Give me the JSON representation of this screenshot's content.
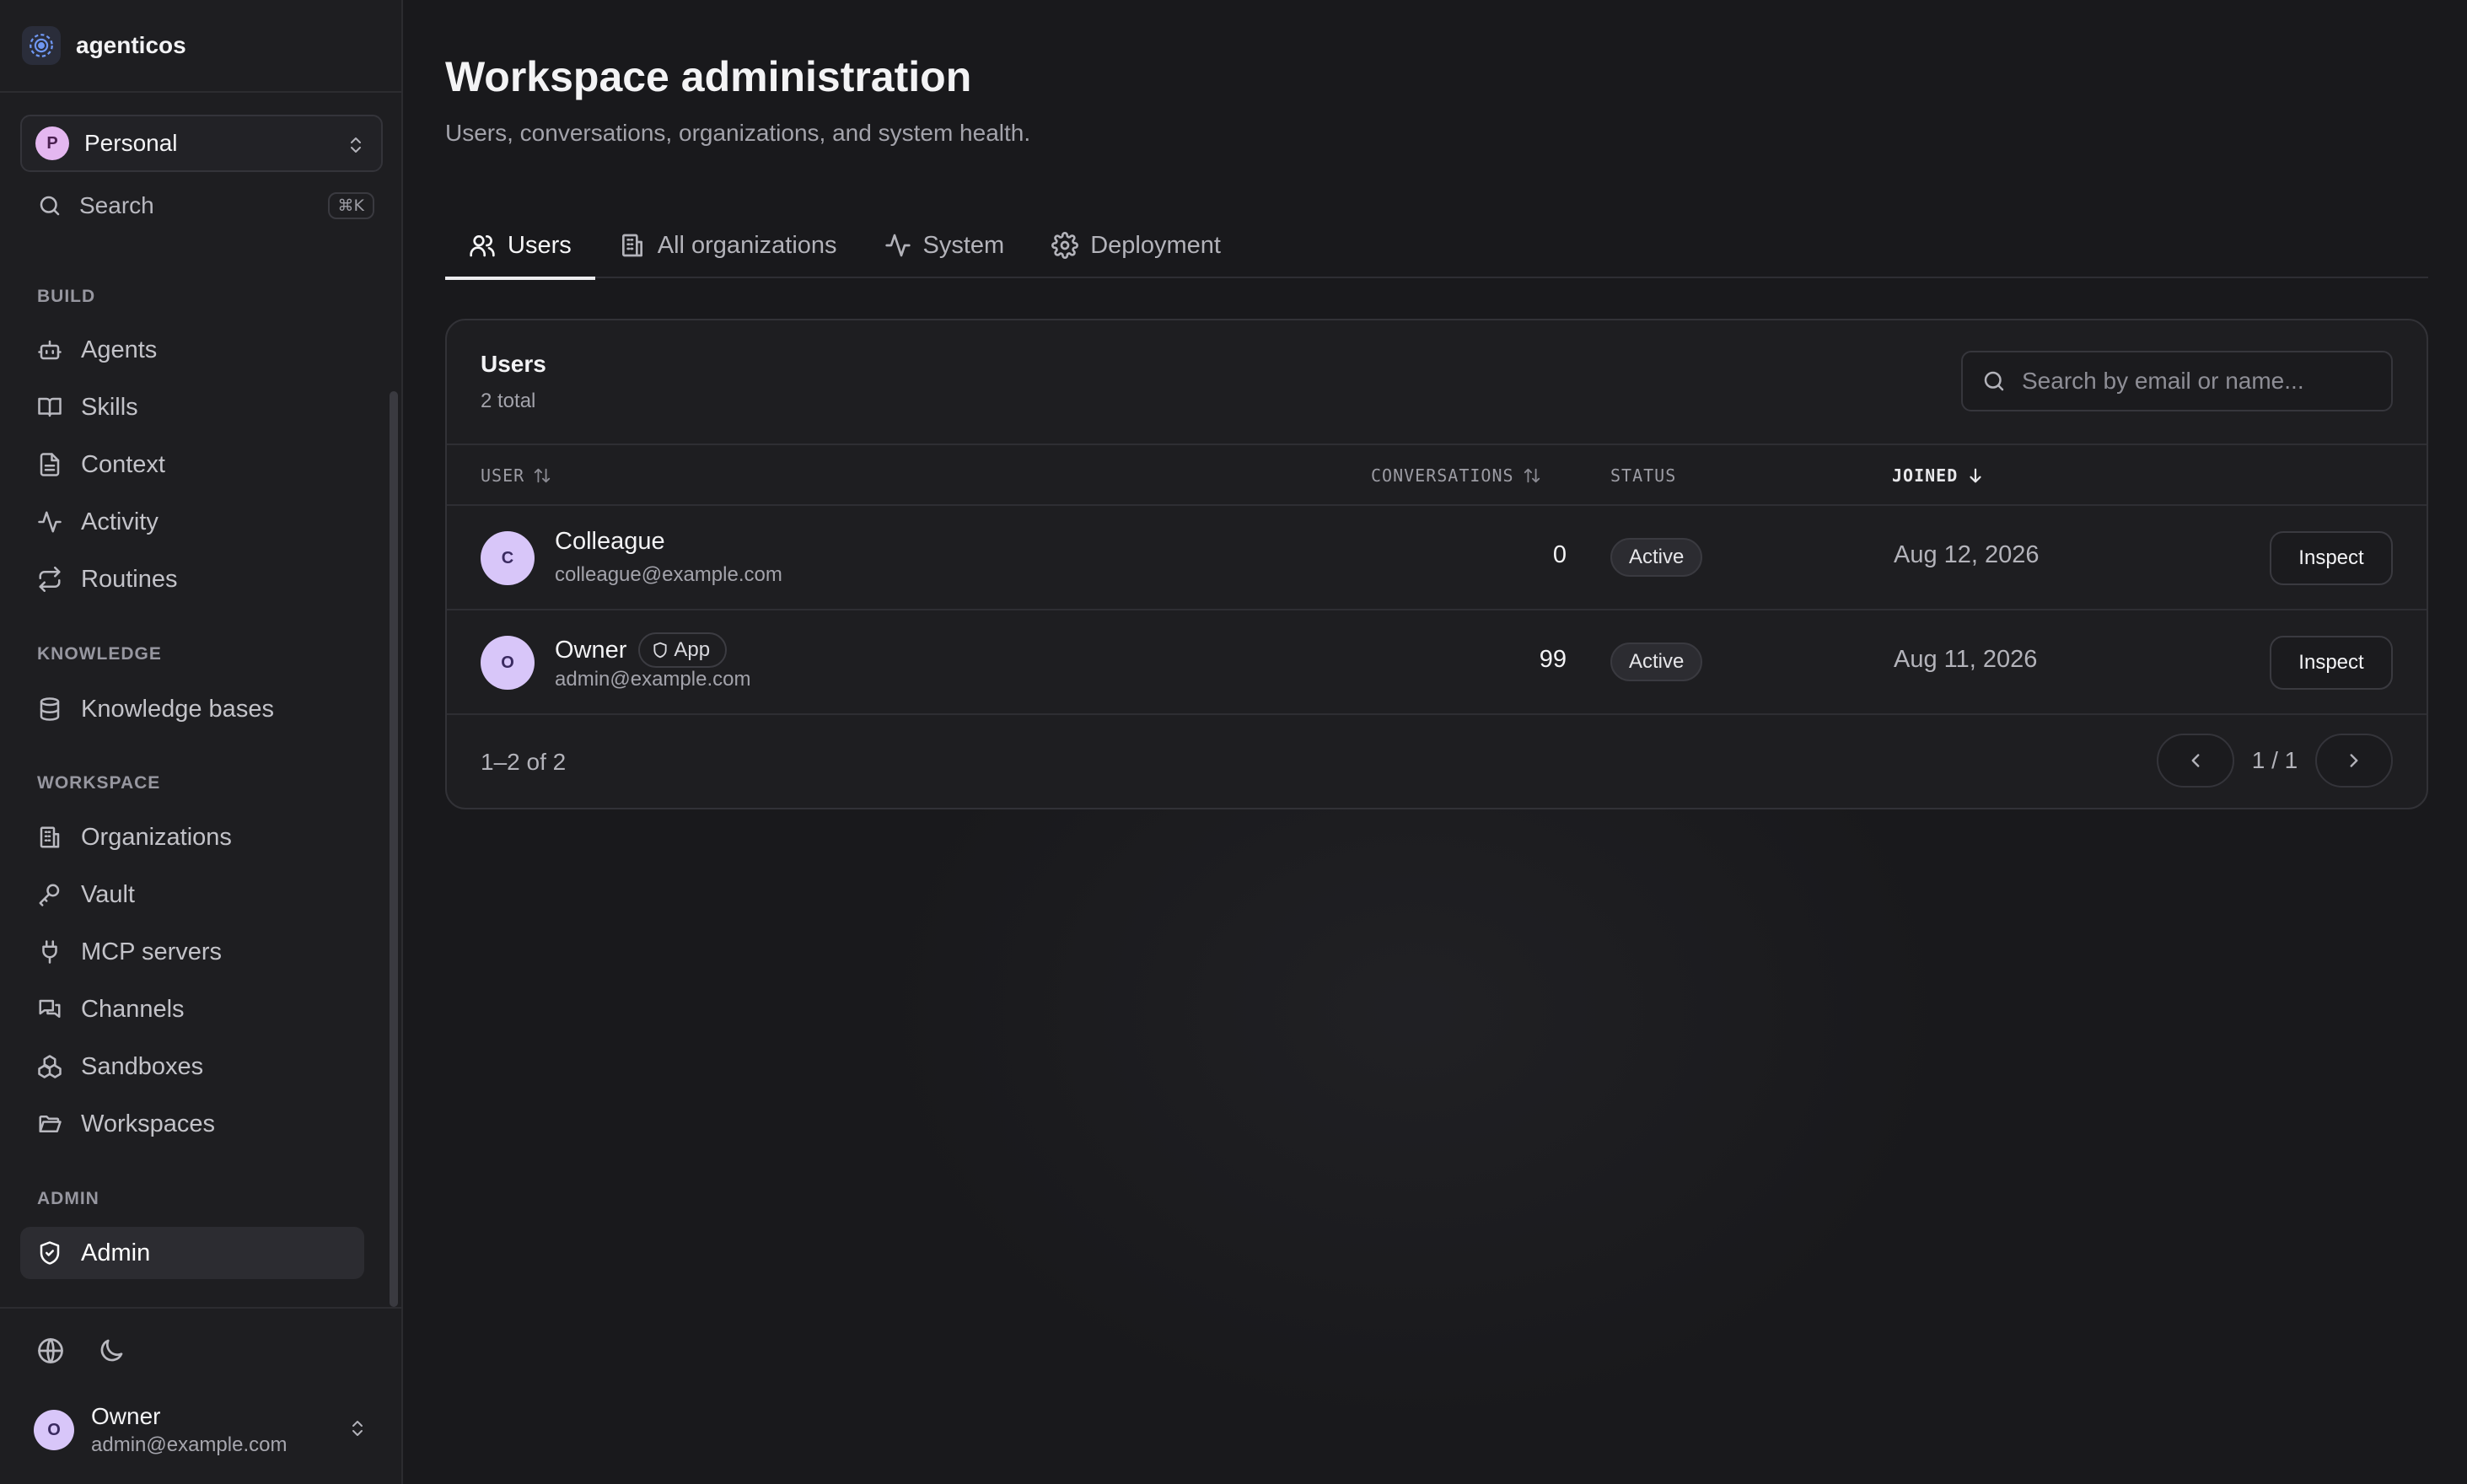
{
  "brand": {
    "name": "agenticos"
  },
  "org_switch": {
    "initial": "P",
    "name": "Personal"
  },
  "search": {
    "label": "Search",
    "shortcut": "⌘K"
  },
  "sidebar": {
    "sections": {
      "build": "BUILD",
      "knowledge": "KNOWLEDGE",
      "workspace": "WORKSPACE",
      "admin": "ADMIN"
    },
    "build_items": [
      "Agents",
      "Skills",
      "Context",
      "Activity",
      "Routines"
    ],
    "knowledge_items": [
      "Knowledge bases"
    ],
    "workspace_items": [
      "Organizations",
      "Vault",
      "MCP servers",
      "Channels",
      "Sandboxes",
      "Workspaces"
    ],
    "admin_items": [
      "Admin"
    ],
    "active_item": "Admin"
  },
  "current_user": {
    "initial": "O",
    "name": "Owner",
    "email": "admin@example.com"
  },
  "page": {
    "title": "Workspace administration",
    "subtitle": "Users, conversations, organizations, and system health."
  },
  "tabs": [
    "Users",
    "All organizations",
    "System",
    "Deployment"
  ],
  "active_tab": "Users",
  "users_card": {
    "title": "Users",
    "count_text": "2 total",
    "search_placeholder": "Search by email or name...",
    "columns": {
      "user": "USER",
      "conversations": "CONVERSATIONS",
      "status": "STATUS",
      "joined": "JOINED"
    },
    "rows": [
      {
        "initial": "C",
        "name": "Colleague",
        "email": "colleague@example.com",
        "badge": "",
        "conversations": "0",
        "status": "Active",
        "joined": "Aug 12, 2026",
        "action": "Inspect"
      },
      {
        "initial": "O",
        "name": "Owner",
        "email": "admin@example.com",
        "badge": "App",
        "conversations": "99",
        "status": "Active",
        "joined": "Aug 11, 2026",
        "action": "Inspect"
      }
    ],
    "range_text": "1–2 of 2",
    "page_indicator": "1 / 1"
  },
  "colors": {
    "background": "#19191c",
    "sidebar": "#1e1e21",
    "avatar": "#d8c6f9",
    "org_avatar": "#e4b7f0",
    "brand_accent": "#5b8def"
  }
}
